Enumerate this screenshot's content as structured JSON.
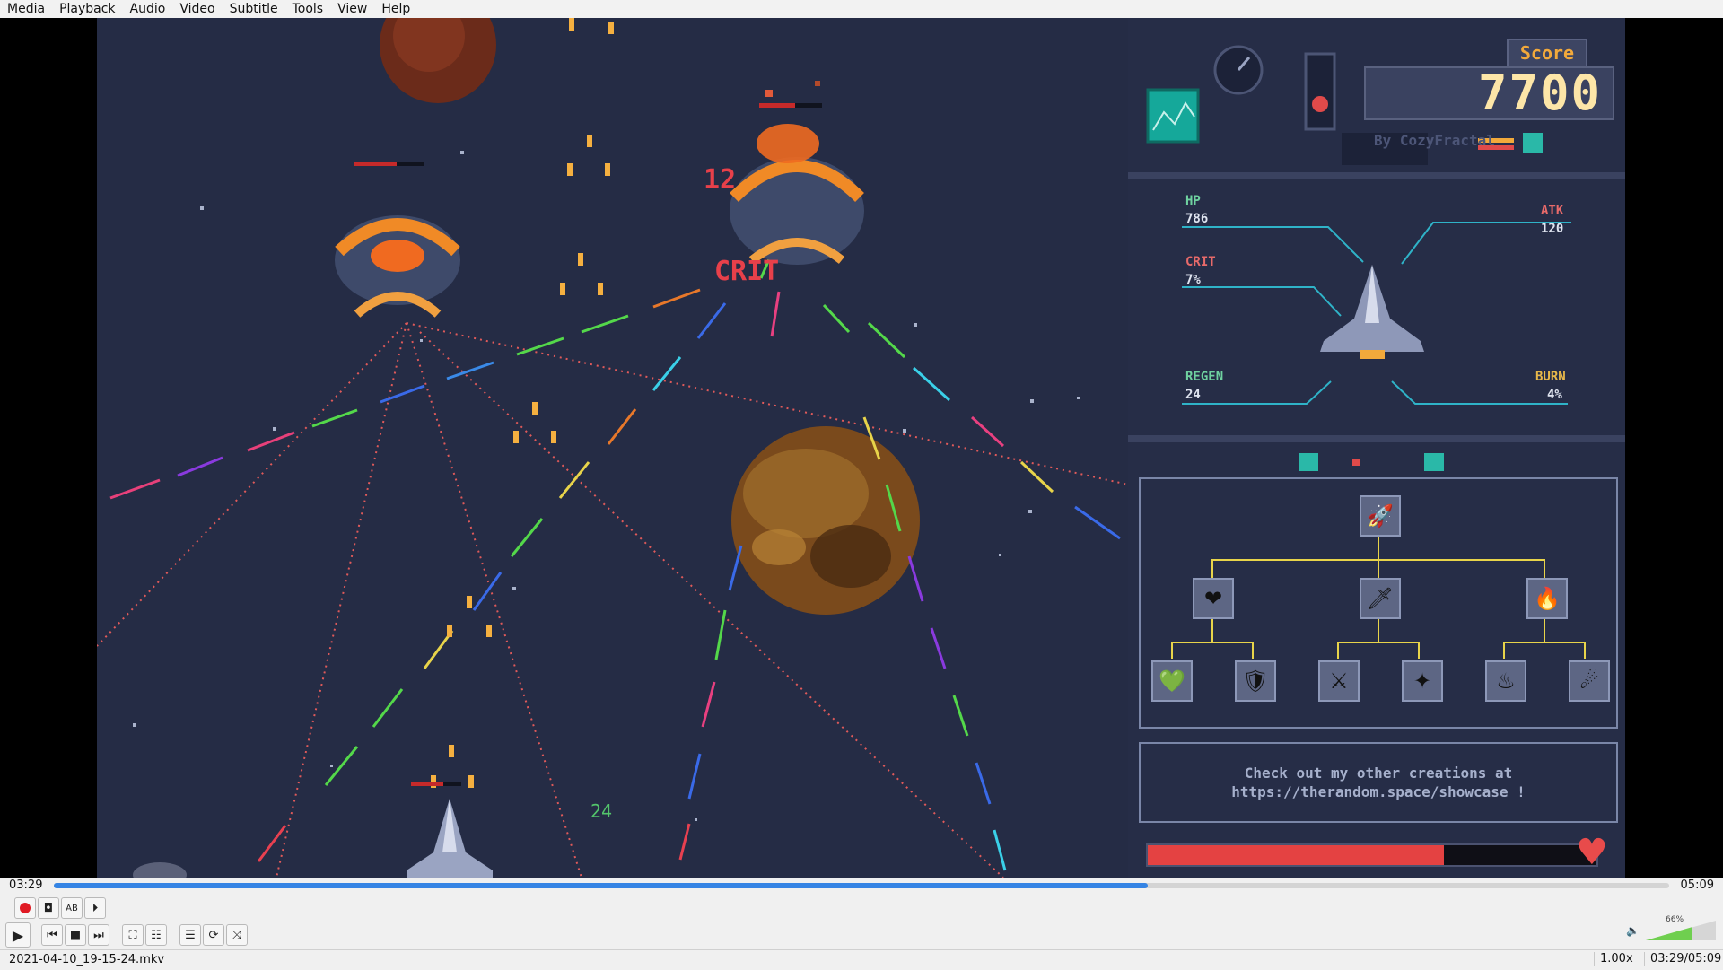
{
  "menu": [
    "Media",
    "Playback",
    "Audio",
    "Video",
    "Subtitle",
    "Tools",
    "View",
    "Help"
  ],
  "game": {
    "score_title": "Score",
    "score_value": "7700",
    "credit": "By CozyFractal",
    "stats": {
      "hp_label": "HP",
      "hp_value": "786",
      "atk_label": "ATK",
      "atk_value": "120",
      "crit_label": "CRIT",
      "crit_value": "7%",
      "regen_label": "REGEN",
      "regen_value": "24",
      "burn_label": "BURN",
      "burn_value": "4%"
    },
    "damage_text_1": "12",
    "damage_text_2": "CRIT",
    "regen_popup": "24",
    "message_line1": "Check out my other creations at",
    "message_line2": "https://therandom.space/showcase !",
    "hp_fraction": 0.66
  },
  "player": {
    "time_current": "03:29",
    "time_total": "05:09",
    "progress_fraction": 0.677,
    "filename": "2021-04-10_19-15-24.mkv",
    "speed": "1.00x",
    "time_combined": "03:29/05:09",
    "volume_percent": "66%"
  },
  "colors": {
    "accent": "#3584e4",
    "game_bg": "#252c45",
    "hp_red": "#e44242"
  }
}
